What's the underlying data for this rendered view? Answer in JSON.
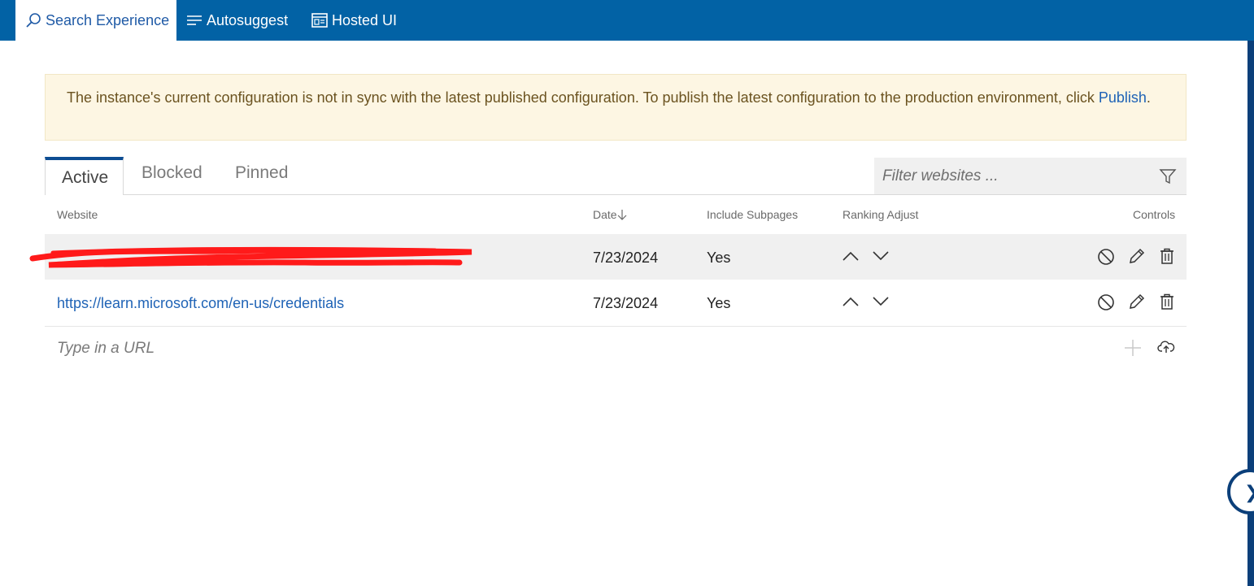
{
  "nav": {
    "tabs": [
      {
        "label": "Search Experience",
        "icon": "search-icon",
        "active": true
      },
      {
        "label": "Autosuggest",
        "icon": "list-icon",
        "active": false
      },
      {
        "label": "Hosted UI",
        "icon": "window-icon",
        "active": false
      }
    ]
  },
  "banner": {
    "text": "The instance's current configuration is not in sync with the latest published configuration. To publish the latest configuration to the production environment, click",
    "link": "Publish",
    "end": "."
  },
  "subtabs": [
    "Active",
    "Blocked",
    "Pinned"
  ],
  "filter": {
    "placeholder": "Filter websites ..."
  },
  "table": {
    "headers": {
      "website": "Website",
      "date": "Date",
      "subpages": "Include Subpages",
      "ranking": "Ranking Adjust",
      "controls": "Controls"
    },
    "rows": [
      {
        "website": "",
        "redacted": true,
        "date": "7/23/2024",
        "subpages": "Yes"
      },
      {
        "website": "https://learn.microsoft.com/en-us/credentials",
        "redacted": false,
        "date": "7/23/2024",
        "subpages": "Yes"
      }
    ]
  },
  "url_input": {
    "placeholder": "Type in a URL"
  },
  "colors": {
    "nav": "#0262a5",
    "accent": "#1f63b6",
    "banner_bg": "#fdf6e3",
    "row_alt": "#f0f0f0",
    "redaction": "#ff0000"
  }
}
